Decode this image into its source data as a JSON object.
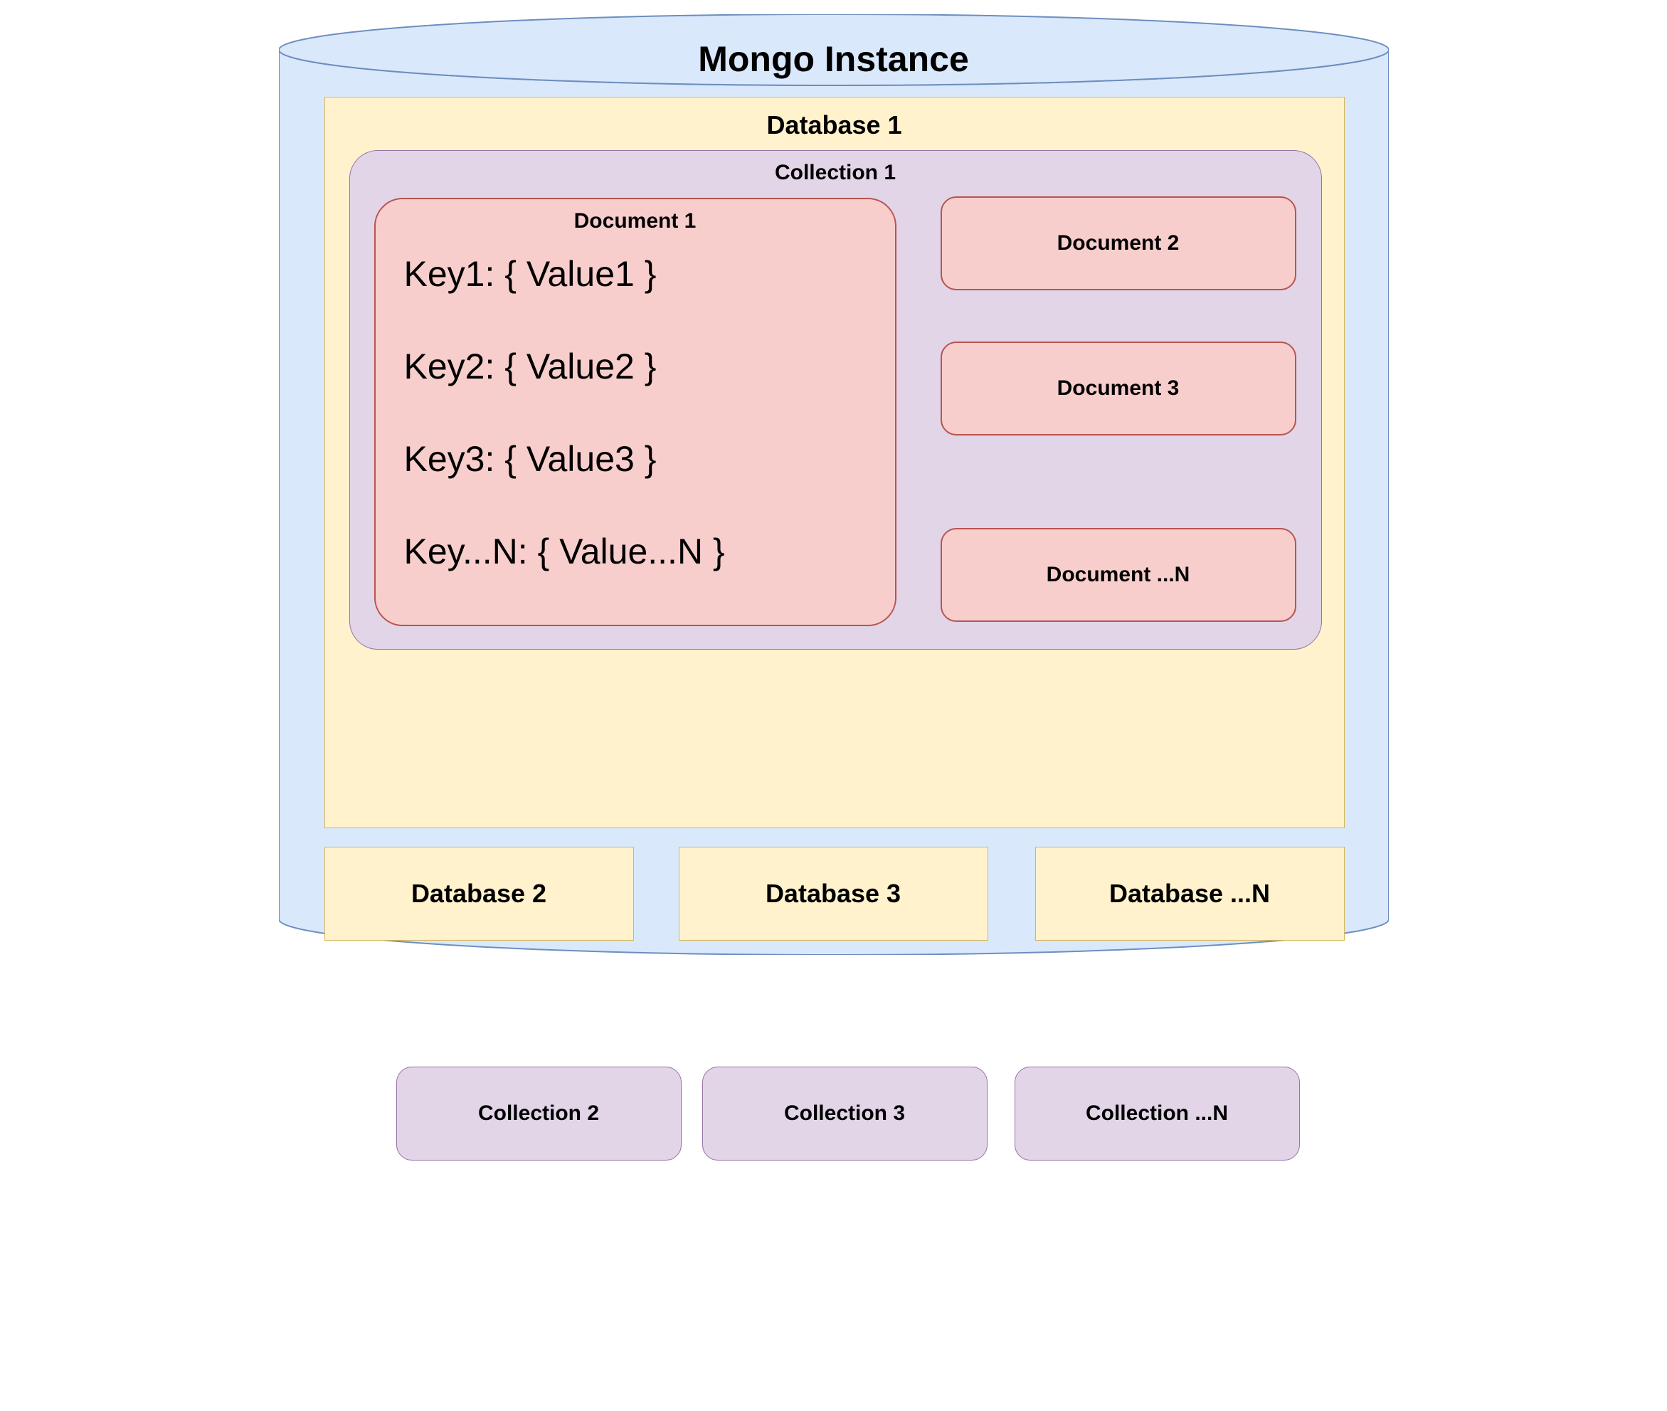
{
  "instance": {
    "title": "Mongo Instance"
  },
  "database_main": {
    "title": "Database 1"
  },
  "collection_main": {
    "title": "Collection 1"
  },
  "document_main": {
    "title": "Document 1",
    "keys": {
      "k1": "Key1: { Value1 }",
      "k2": "Key2: { Value2 }",
      "k3": "Key3: { Value3 }",
      "kN": "Key...N: { Value...N }"
    }
  },
  "documents": {
    "d2": "Document 2",
    "d3": "Document 3",
    "dN": "Document ...N"
  },
  "collections": {
    "c2": "Collection 2",
    "c3": "Collection 3",
    "cN": "Collection ...N"
  },
  "databases": {
    "db2": "Database 2",
    "db3": "Database 3",
    "dbN": "Database ...N"
  },
  "colors": {
    "cylinder_fill": "#dae8fc",
    "cylinder_stroke": "#6c8ebf",
    "database_fill": "#fff2cc",
    "database_stroke": "#d6b656",
    "collection_fill": "#e1d5e7",
    "collection_stroke": "#9673a6",
    "document_fill": "#f8cecc",
    "document_stroke": "#b85450"
  }
}
